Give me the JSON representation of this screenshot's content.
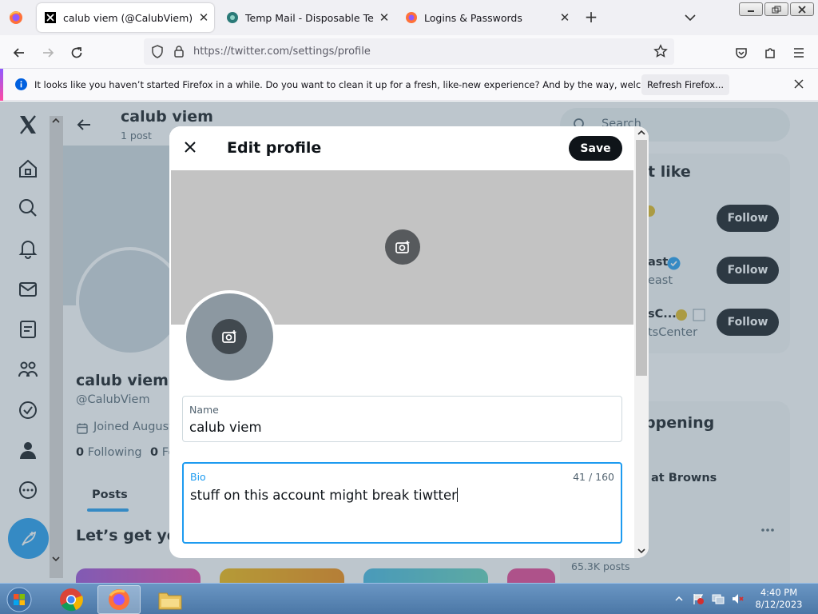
{
  "browser": {
    "tabs": [
      {
        "title": "calub viem (@CalubViem) / X",
        "active": true,
        "icon": "x-logo-icon"
      },
      {
        "title": "Temp Mail - Disposable Tempor",
        "active": false,
        "icon": "tempmail-icon"
      },
      {
        "title": "Logins & Passwords",
        "active": false,
        "icon": "firefox-icon"
      }
    ],
    "new_tab_label": "+",
    "url": "https://twitter.com/settings/profile",
    "notification": {
      "text": "It looks like you haven’t started Firefox in a while. Do you want to clean it up for a fresh, like-new experience? And by the way, welcome back!",
      "button_label": "Refresh Firefox..."
    }
  },
  "profile_page": {
    "header_name": "calub viem",
    "post_count": "1 post",
    "display_name": "calub viem",
    "handle": "@CalubViem",
    "joined": "Joined August",
    "following_count": "0",
    "following_label": "Following",
    "followers_count": "0",
    "followers_label": "Fo",
    "tab_posts": "Posts",
    "lets_get_text": "Let’s get you"
  },
  "right_column": {
    "search_placeholder": "Search",
    "who_to_follow_partial": "t like",
    "suggestions": [
      {
        "name_partial": "",
        "handle_partial": "",
        "follow_label": "Follow"
      },
      {
        "name_partial": "ast",
        "handle_partial": "east",
        "follow_label": "Follow"
      },
      {
        "name_partial": "sC...",
        "handle_partial": "tsCenter",
        "follow_label": "Follow"
      }
    ],
    "happening_partial": "ppening",
    "trend_partial": "at Browns",
    "trend_posts": "65.3K posts"
  },
  "modal": {
    "title": "Edit profile",
    "save_label": "Save",
    "name_label": "Name",
    "name_value": "calub viem",
    "bio_label": "Bio",
    "bio_value": "stuff on this account might break tiwtter",
    "bio_counter": "41 / 160"
  },
  "taskbar": {
    "time": "4:40 PM",
    "date": "8/12/2023"
  },
  "colors": {
    "accent": "#1d9bf0",
    "dark": "#0f1419",
    "banner": "#c3c3c3",
    "avatar": "#8c98a1"
  }
}
